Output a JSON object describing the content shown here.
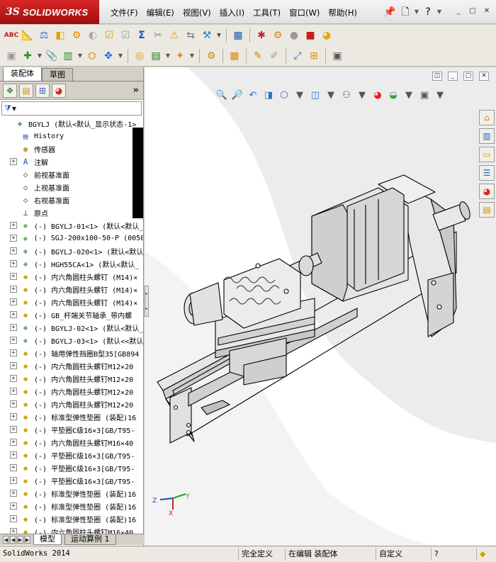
{
  "app": {
    "logo_mark": "3S",
    "logo_text": "SOLIDWORKS"
  },
  "menu": [
    "文件(F)",
    "编辑(E)",
    "视图(V)",
    "插入(I)",
    "工具(T)",
    "窗口(W)",
    "帮助(H)"
  ],
  "title_icons": [
    "pushpin-icon",
    "new-doc-icon",
    "help-icon",
    "window-icon"
  ],
  "window_controls": {
    "minimize": "_",
    "restore": "▢",
    "close": "✕"
  },
  "left_panel": {
    "tabs": [
      "装配体",
      "草图"
    ],
    "active_tab": 0,
    "manager_icons": [
      "feature-manager-icon",
      "property-manager-icon",
      "configuration-manager-icon",
      "display-manager-icon"
    ],
    "more_label": "»",
    "filter_label": "▼"
  },
  "tree": [
    {
      "label": "BGYLJ  (默认<默认_显示状态-1>",
      "icon": "assembly-icon",
      "expander": "",
      "indent": 0
    },
    {
      "label": "History",
      "icon": "history-icon",
      "expander": "",
      "indent": 1
    },
    {
      "label": "传感器",
      "icon": "sensor-icon",
      "expander": "",
      "indent": 1
    },
    {
      "label": "注解",
      "icon": "annotation-icon",
      "expander": "+",
      "indent": 1
    },
    {
      "label": "前视基准面",
      "icon": "plane-icon",
      "expander": "",
      "indent": 1
    },
    {
      "label": "上视基准面",
      "icon": "plane-icon",
      "expander": "",
      "indent": 1
    },
    {
      "label": "右视基准面",
      "icon": "plane-icon",
      "expander": "",
      "indent": 1
    },
    {
      "label": "原点",
      "icon": "origin-icon",
      "expander": "",
      "indent": 1
    },
    {
      "label": "(-) BGYLJ-01<1> (默认<默认_",
      "icon": "subassembly-icon",
      "expander": "+",
      "indent": 1
    },
    {
      "label": "(-) SGJ-200x100-50-P (0050",
      "icon": "subassembly-icon",
      "expander": "+",
      "indent": 1
    },
    {
      "label": "(-) BGYLJ-020<1> (默认<默认",
      "icon": "subassembly-icon",
      "expander": "+",
      "indent": 1
    },
    {
      "label": "(-) HGH55CA<1> (默认<默认_",
      "icon": "subassembly-icon",
      "expander": "+",
      "indent": 1
    },
    {
      "label": "(-) 内六角圆柱头螺钉 (M14)×",
      "icon": "part-icon",
      "expander": "+",
      "indent": 1
    },
    {
      "label": "(-) 内六角圆柱头螺钉 (M14)×",
      "icon": "part-icon",
      "expander": "+",
      "indent": 1
    },
    {
      "label": "(-) 内六角圆柱头螺钉 (M14)×",
      "icon": "part-icon",
      "expander": "+",
      "indent": 1
    },
    {
      "label": "(-) GB_杆端关节轴承_带内螺",
      "icon": "part-icon",
      "expander": "+",
      "indent": 1
    },
    {
      "label": "(-) BGYLJ-02<1> (默认<默认_",
      "icon": "subassembly-icon",
      "expander": "+",
      "indent": 1
    },
    {
      "label": "(-) BGYLJ-03<1> (默认<<默认",
      "icon": "subassembly-icon",
      "expander": "+",
      "indent": 1
    },
    {
      "label": "(-) 轴用弹性挡圈B型35[GB894",
      "icon": "part-icon",
      "expander": "+",
      "indent": 1
    },
    {
      "label": "(-) 内六角圆柱头螺钉M12×20",
      "icon": "part-icon",
      "expander": "+",
      "indent": 1
    },
    {
      "label": "(-) 内六角圆柱头螺钉M12×20",
      "icon": "part-icon",
      "expander": "+",
      "indent": 1
    },
    {
      "label": "(-) 内六角圆柱头螺钉M12×20",
      "icon": "part-icon",
      "expander": "+",
      "indent": 1
    },
    {
      "label": "(-) 内六角圆柱头螺钉M12×20",
      "icon": "part-icon",
      "expander": "+",
      "indent": 1
    },
    {
      "label": "(-) 标准型弹性垫圈 (装配)16",
      "icon": "part-icon",
      "expander": "+",
      "indent": 1
    },
    {
      "label": "(-) 平垫圈C级16×3[GB/T95-",
      "icon": "part-icon",
      "expander": "+",
      "indent": 1
    },
    {
      "label": "(-) 内六角圆柱头螺钉M16×40",
      "icon": "part-icon",
      "expander": "+",
      "indent": 1
    },
    {
      "label": "(-) 平垫圈C级16×3[GB/T95-",
      "icon": "part-icon",
      "expander": "+",
      "indent": 1
    },
    {
      "label": "(-) 平垫圈C级16×3[GB/T95-",
      "icon": "part-icon",
      "expander": "+",
      "indent": 1
    },
    {
      "label": "(-) 平垫圈C级16×3[GB/T95-",
      "icon": "part-icon",
      "expander": "+",
      "indent": 1
    },
    {
      "label": "(-) 标准型弹性垫圈 (装配)16",
      "icon": "part-icon",
      "expander": "+",
      "indent": 1
    },
    {
      "label": "(-) 标准型弹性垫圈 (装配)16",
      "icon": "part-icon",
      "expander": "+",
      "indent": 1
    },
    {
      "label": "(-) 标准型弹性垫圈 (装配)16",
      "icon": "part-icon",
      "expander": "+",
      "indent": 1
    },
    {
      "label": "(-) 内六角圆柱头螺钉M16×40",
      "icon": "part-icon",
      "expander": "+",
      "indent": 1
    }
  ],
  "bottom_tabs": [
    "模型",
    "运动算例 1"
  ],
  "triad": {
    "x": "X",
    "y": "Y",
    "z": "Z"
  },
  "status_bar": {
    "app": "SolidWorks 2014",
    "state1": "完全定义",
    "state2": "在编辑 装配体",
    "state3": "自定义",
    "help": "?"
  },
  "colors": {
    "brand_red": "#c21a1a",
    "model_gray": "#d8d8d8",
    "viewport_bg": "#ffffff"
  }
}
